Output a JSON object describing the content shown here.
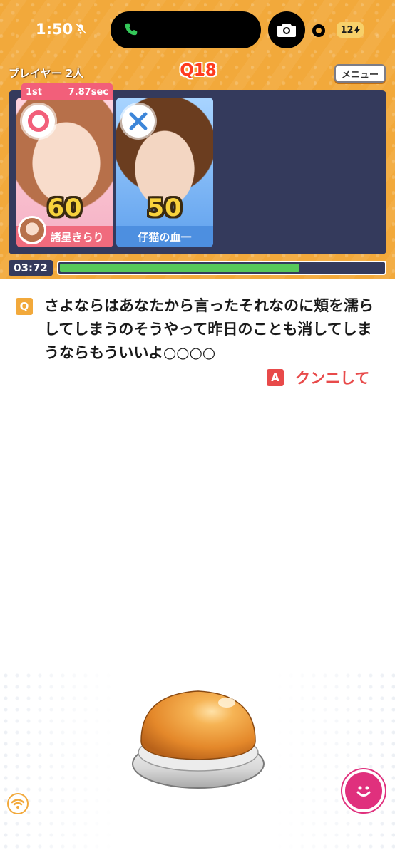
{
  "status_bar": {
    "time": "1:50",
    "battery": "12"
  },
  "header": {
    "players_label": "プレイヤー 2人",
    "question_number": "Q18",
    "menu_label": "メニュー"
  },
  "players": [
    {
      "name": "諸星きらり",
      "score": "60",
      "mark": "correct",
      "rank": "1st",
      "time": "7.87sec",
      "color": "#f06b7d"
    },
    {
      "name": "仔猫の血一",
      "score": "50",
      "mark": "wrong",
      "color": "#4d8fe0"
    }
  ],
  "timer": {
    "label": "03:72",
    "progress_percent": 74
  },
  "question": {
    "badge": "Q",
    "text": "さよならはあなたから言ったそれなのに頬を濡らしてしまうのそうやって昨日のことも消してしまうならもういいよ○○○○"
  },
  "answer": {
    "badge": "A",
    "text": "クンニして"
  },
  "colors": {
    "header_orange": "#f2a93b",
    "panel_navy": "#343a5c",
    "answer_red": "#e84a4a",
    "timer_green": "#57c95a",
    "smile_pink": "#e0307d"
  }
}
